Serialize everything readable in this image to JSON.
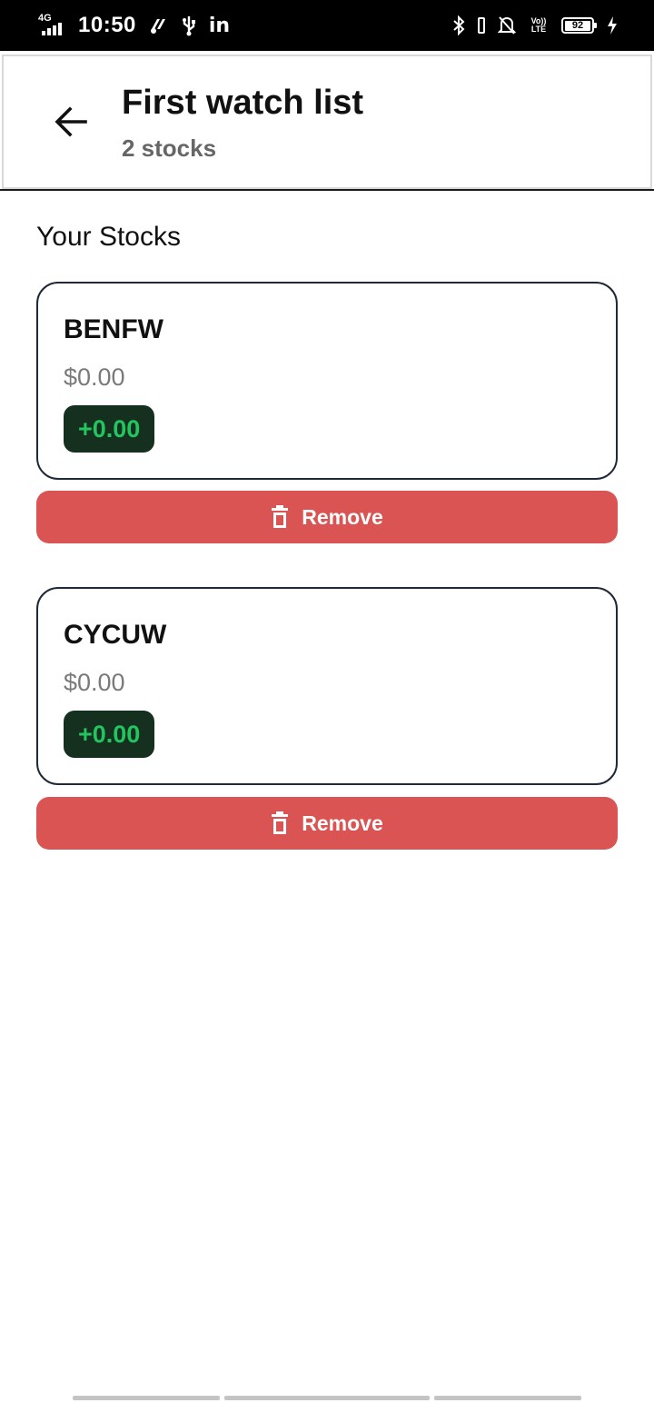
{
  "status_bar": {
    "network": "4G",
    "time": "10:50",
    "battery": "92",
    "icons": [
      "signal-icon",
      "whatsapp-business-icon",
      "usb-icon",
      "linkedin-icon",
      "bluetooth-icon",
      "vibrate-icon",
      "notifications-off-icon",
      "volte-icon",
      "battery-icon",
      "charging-icon"
    ],
    "linkedin_text": "in",
    "volte_text": "Vo)) LTE"
  },
  "header": {
    "title": "First watch list",
    "subtitle": "2 stocks",
    "back_icon": "arrow-left-icon"
  },
  "section_title": "Your Stocks",
  "stocks": [
    {
      "symbol": "BENFW",
      "price": "$0.00",
      "change": "+0.00",
      "remove_label": "Remove"
    },
    {
      "symbol": "CYCUW",
      "price": "$0.00",
      "change": "+0.00",
      "remove_label": "Remove"
    }
  ],
  "colors": {
    "remove_button": "#d95453",
    "change_badge_bg": "#163020",
    "change_positive": "#22c55e",
    "card_border": "#1f2937"
  }
}
